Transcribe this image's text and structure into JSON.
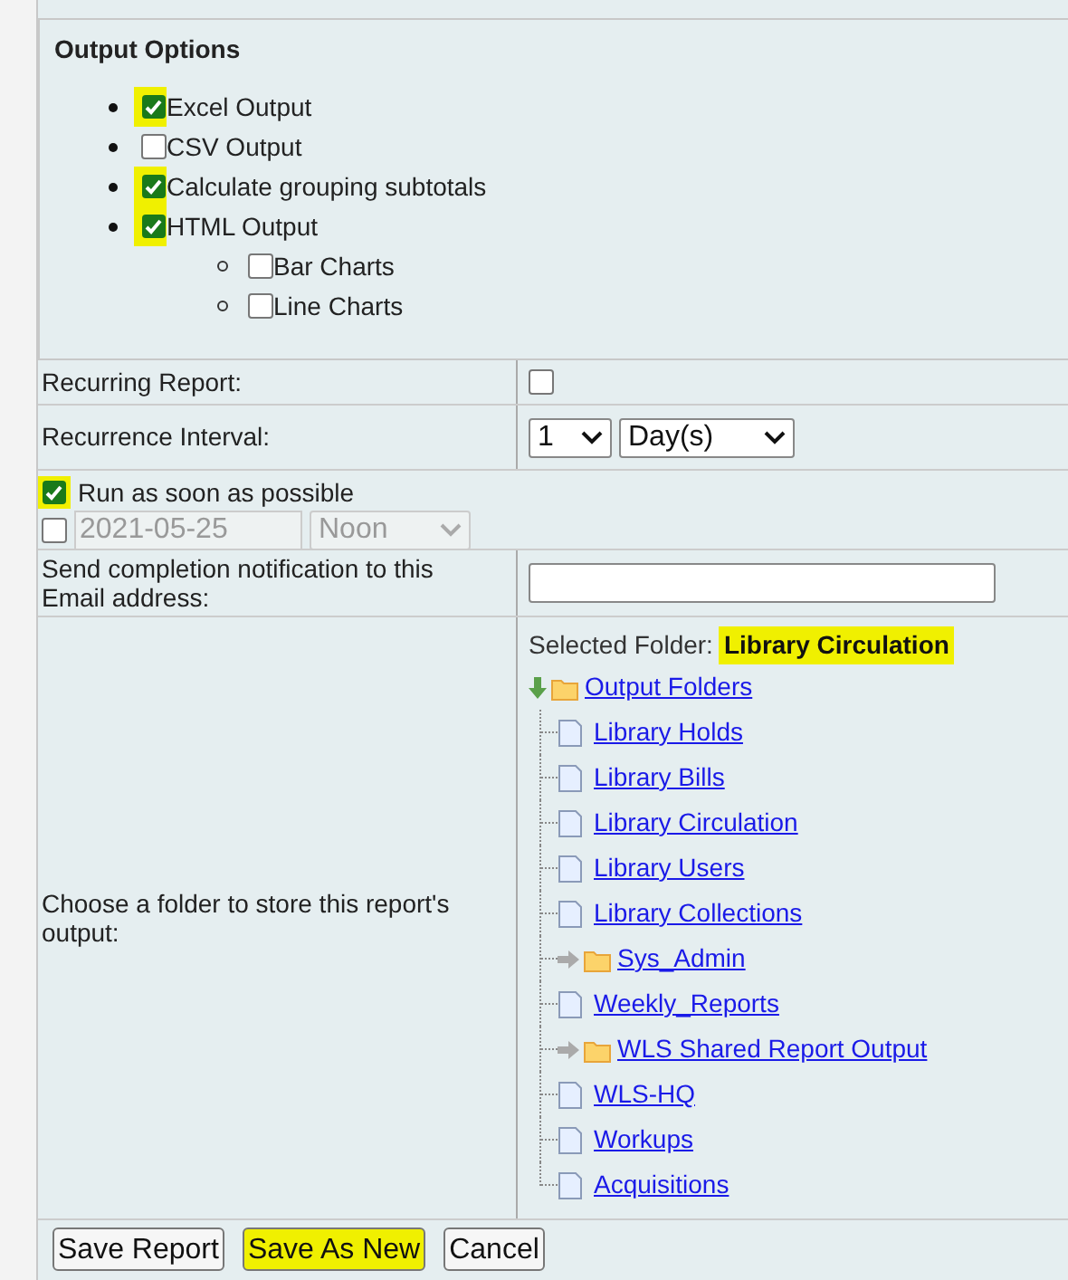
{
  "output_options": {
    "title": "Output Options",
    "options": [
      {
        "label": "Excel Output",
        "checked": true,
        "highlighted": true
      },
      {
        "label": "CSV Output",
        "checked": false,
        "highlighted": false
      },
      {
        "label": "Calculate grouping subtotals",
        "checked": true,
        "highlighted": true
      },
      {
        "label": "HTML Output",
        "checked": true,
        "highlighted": true,
        "children": [
          {
            "label": "Bar Charts",
            "checked": false
          },
          {
            "label": "Line Charts",
            "checked": false
          }
        ]
      }
    ]
  },
  "recurring": {
    "label": "Recurring Report:",
    "checked": false
  },
  "interval": {
    "label": "Recurrence Interval:",
    "count": "1",
    "unit": "Day(s)"
  },
  "run_asap": {
    "label": "Run as soon as possible",
    "checked": true,
    "highlighted": true
  },
  "schedule": {
    "checked": false,
    "date": "2021-05-25",
    "time": "Noon",
    "disabled": true
  },
  "email": {
    "label": "Send completion notification to this Email address:"
  },
  "folder": {
    "label": "Choose a folder to store this report's output:",
    "selected_label": "Selected Folder:",
    "selected_value": "Library Circulation",
    "highlighted": true,
    "tree": [
      {
        "label": "Output Folders",
        "kind": "folder",
        "expanded": true,
        "children": [
          {
            "label": "Library Holds",
            "kind": "file"
          },
          {
            "label": "Library Bills",
            "kind": "file"
          },
          {
            "label": "Library Circulation",
            "kind": "file"
          },
          {
            "label": "Library Users",
            "kind": "file"
          },
          {
            "label": "Library Collections",
            "kind": "file"
          },
          {
            "label": "Sys_Admin",
            "kind": "folder",
            "expanded": false
          },
          {
            "label": "Weekly_Reports",
            "kind": "file"
          },
          {
            "label": "WLS Shared Report Output",
            "kind": "folder",
            "expanded": false
          },
          {
            "label": "WLS-HQ",
            "kind": "file"
          },
          {
            "label": "Workups",
            "kind": "file"
          },
          {
            "label": "Acquisitions",
            "kind": "file"
          }
        ]
      }
    ]
  },
  "buttons": [
    {
      "label": "Save Report",
      "highlighted": false
    },
    {
      "label": "Save As New",
      "highlighted": true
    },
    {
      "label": "Cancel",
      "highlighted": false
    }
  ]
}
